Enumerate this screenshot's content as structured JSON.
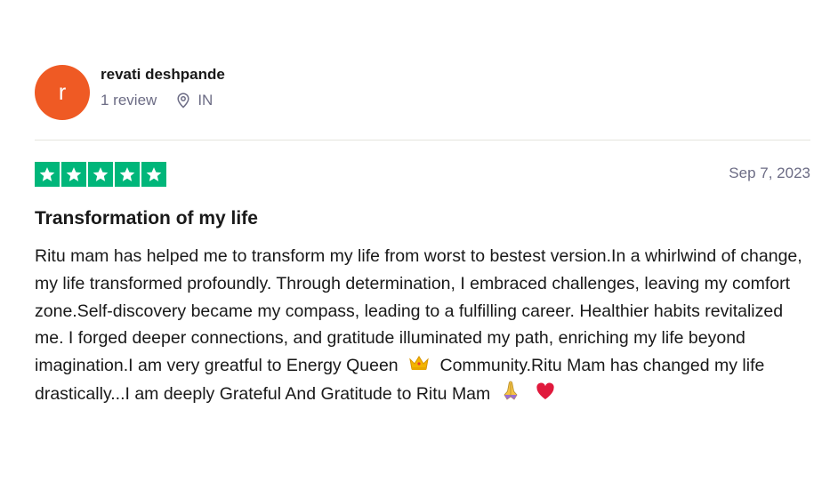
{
  "reviewer": {
    "initial": "r",
    "name": "revati deshpande",
    "review_count": "1 review",
    "location": "IN",
    "avatar_color": "#ef5a24"
  },
  "review": {
    "rating": 5,
    "star_color": "#00b67a",
    "date": "Sep 7, 2023",
    "title": "Transformation of my life",
    "body_part1": "Ritu mam has helped me to transform my life from worst to bestest version.In a whirlwind of change, my life transformed profoundly. Through determination, I embraced challenges, leaving my comfort zone.Self-discovery became my compass, leading to a fulfilling career. Healthier habits revitalized me. I forged deeper connections, and gratitude illuminated my path, enriching my life beyond imagination.I am very greatful to Energy Queen",
    "body_part2": "Community.Ritu Mam has changed my life drastically...I am deeply Grateful And Gratitude to Ritu Mam",
    "emojis": [
      "crown-emoji",
      "folded-hands-emoji",
      "red-heart-emoji"
    ]
  }
}
